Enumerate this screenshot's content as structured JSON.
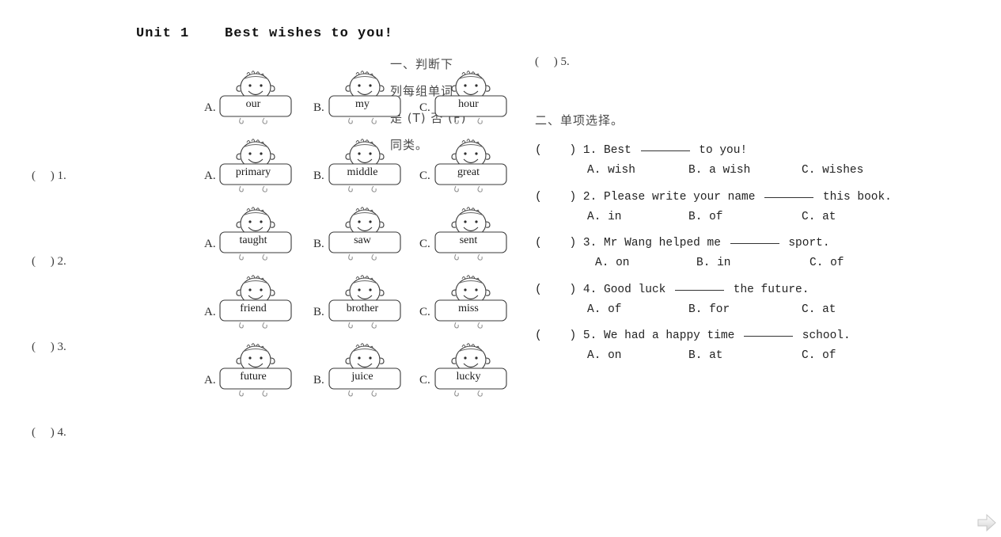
{
  "document": {
    "title": "Unit 1    Best wishes to you!"
  },
  "colors": {
    "divider": "#46607c",
    "text": "#222222",
    "ink": "#3d3d3d"
  },
  "section_one": {
    "instruction_lines": [
      "一、判断下",
      "列每组单词",
      "是 (T) 否 (F)",
      "同类。"
    ],
    "instruction_full": "一、判断下列每组单词是 (T) 否 (F) 同类。",
    "brackets": [
      "(     ) 1.",
      "(     ) 2.",
      "(     ) 3.",
      "(     ) 4."
    ],
    "bracket_right": "(     ) 5.",
    "rows": [
      {
        "items": [
          {
            "letter": "A.",
            "word": "our"
          },
          {
            "letter": "B.",
            "word": "my"
          },
          {
            "letter": "C.",
            "word": "hour"
          }
        ]
      },
      {
        "items": [
          {
            "letter": "A.",
            "word": "primary"
          },
          {
            "letter": "B.",
            "word": "middle"
          },
          {
            "letter": "C.",
            "word": "great"
          }
        ]
      },
      {
        "items": [
          {
            "letter": "A.",
            "word": "taught"
          },
          {
            "letter": "B.",
            "word": "saw"
          },
          {
            "letter": "C.",
            "word": "sent"
          }
        ]
      },
      {
        "items": [
          {
            "letter": "A.",
            "word": "friend"
          },
          {
            "letter": "B.",
            "word": "brother"
          },
          {
            "letter": "C.",
            "word": "miss"
          }
        ]
      },
      {
        "items": [
          {
            "letter": "A.",
            "word": "future"
          },
          {
            "letter": "B.",
            "word": "juice"
          },
          {
            "letter": "C.",
            "word": "lucky"
          }
        ]
      }
    ]
  },
  "section_two": {
    "heading": "二、单项选择。",
    "questions": [
      {
        "bracket": "(    ) 1.",
        "stem_before": " Best ",
        "stem_after": " to you!",
        "options": [
          "A. wish",
          "B. a wish",
          "C. wishes"
        ],
        "indent": false
      },
      {
        "bracket": "(    ) 2.",
        "stem_before": " Please write your name ",
        "stem_after": " this book.",
        "options": [
          "A. in",
          "B. of",
          "C. at"
        ],
        "indent": false
      },
      {
        "bracket": "(    ) 3.",
        "stem_before": " Mr Wang helped me ",
        "stem_after": " sport.",
        "options": [
          "A. on",
          "B. in",
          "C. of"
        ],
        "indent": true
      },
      {
        "bracket": "(    ) 4.",
        "stem_before": " Good luck ",
        "stem_after": " the future.",
        "options": [
          "A. of",
          "B. for",
          "C. at"
        ],
        "indent": false
      },
      {
        "bracket": "(    ) 5.",
        "stem_before": " We had a happy time ",
        "stem_after": " school.",
        "options": [
          "A. on",
          "B. at",
          "C. of"
        ],
        "indent": false
      }
    ]
  },
  "navigation": {
    "next_label": "next-page"
  }
}
